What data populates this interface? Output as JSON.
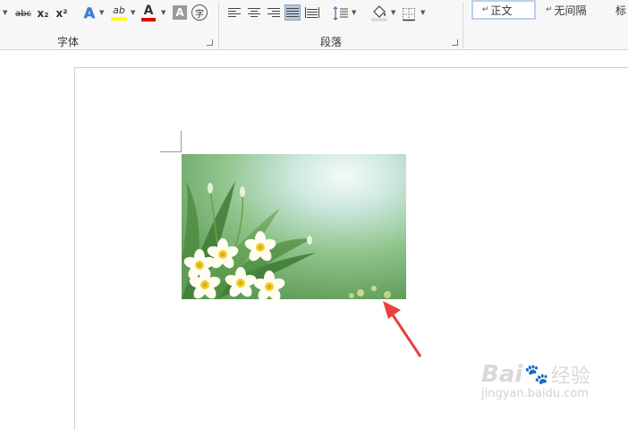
{
  "ribbon": {
    "font_group": {
      "label": "字体",
      "strikethrough_label": "abc",
      "subscript_label": "x₂",
      "superscript_label": "x²",
      "text_effects_label": "A",
      "highlight_label": "ab",
      "font_color_label": "A",
      "char_shading_label": "A",
      "enclose_char_label": "字"
    },
    "paragraph_group": {
      "label": "段落"
    },
    "styles": {
      "items": [
        {
          "label": "正文",
          "marker": "↵",
          "selected": true
        },
        {
          "label": "无间隔",
          "marker": "↵",
          "selected": false
        },
        {
          "label": "标",
          "marker": "",
          "selected": false
        }
      ]
    }
  },
  "colors": {
    "highlight": "#ffff00",
    "font_color": "#e00000",
    "annotation_arrow": "#e8403f",
    "selected_style_border": "#bcd0ec",
    "active_align": "#b8c8de"
  },
  "watermark": {
    "brand": "Bai",
    "brand_suffix": "经验",
    "url": "jingyan.baidu.com"
  }
}
